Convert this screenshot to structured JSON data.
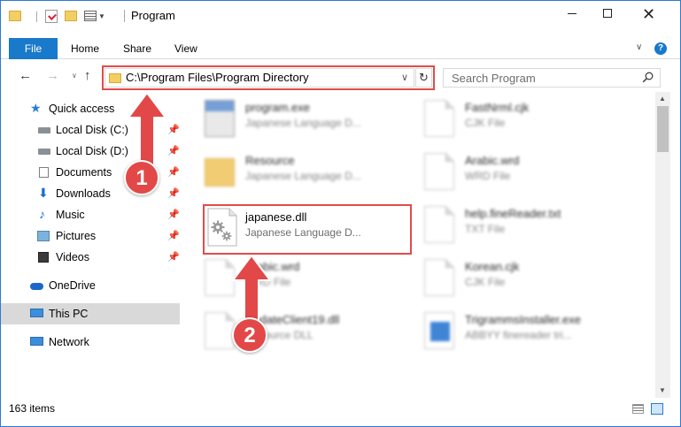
{
  "window": {
    "title": "Program",
    "accent": "#1979ca"
  },
  "ribbon": {
    "file": "File",
    "home": "Home",
    "share": "Share",
    "view": "View"
  },
  "navigation": {
    "address": "C:\\Program Files\\Program Directory",
    "search_placeholder": "Search Program"
  },
  "sidebar": {
    "items": [
      {
        "label": "Quick access",
        "icon": "star-icon"
      },
      {
        "label": "Local Disk (C:)",
        "icon": "disk-icon",
        "pinned": true
      },
      {
        "label": "Local Disk (D:)",
        "icon": "disk-icon",
        "pinned": true
      },
      {
        "label": "Documents",
        "icon": "documents-icon",
        "pinned": true
      },
      {
        "label": "Downloads",
        "icon": "download-icon",
        "pinned": true
      },
      {
        "label": "Music",
        "icon": "music-icon",
        "pinned": true
      },
      {
        "label": "Pictures",
        "icon": "pictures-icon",
        "pinned": true
      },
      {
        "label": "Videos",
        "icon": "videos-icon",
        "pinned": true
      },
      {
        "label": "OneDrive",
        "icon": "cloud-icon"
      },
      {
        "label": "This PC",
        "icon": "pc-icon",
        "selected": true
      },
      {
        "label": "Network",
        "icon": "network-icon"
      }
    ]
  },
  "files": [
    {
      "name": "program.exe",
      "desc": "Japanese Language D...",
      "icon": "exe-icon"
    },
    {
      "name": "FastNrml.cjk",
      "desc": "CJK File",
      "icon": "file-icon"
    },
    {
      "name": "Resource",
      "desc": "Japanese Language D...",
      "icon": "folder-icon"
    },
    {
      "name": "Arabic.wrd",
      "desc": "WRD File",
      "icon": "file-icon"
    },
    {
      "name": "japanese.dll",
      "desc": "Japanese Language D...",
      "icon": "dll-gear-icon"
    },
    {
      "name": "help.fineReader.txt",
      "desc": "TXT File",
      "icon": "file-icon"
    },
    {
      "name": "Arabic.wrd",
      "desc": "WRD File",
      "icon": "file-icon"
    },
    {
      "name": "Korean.cjk",
      "desc": "CJK File",
      "icon": "file-icon"
    },
    {
      "name": "UpdateClient19.dll",
      "desc": "Resource DLL",
      "icon": "dll-icon"
    },
    {
      "name": "TrigrammsInstaller.exe",
      "desc": "ABBYY finereader tri...",
      "icon": "app-icon"
    }
  ],
  "status": {
    "count": "163 items"
  },
  "annotations": {
    "step1": "1",
    "step2": "2",
    "color": "#e34848"
  }
}
